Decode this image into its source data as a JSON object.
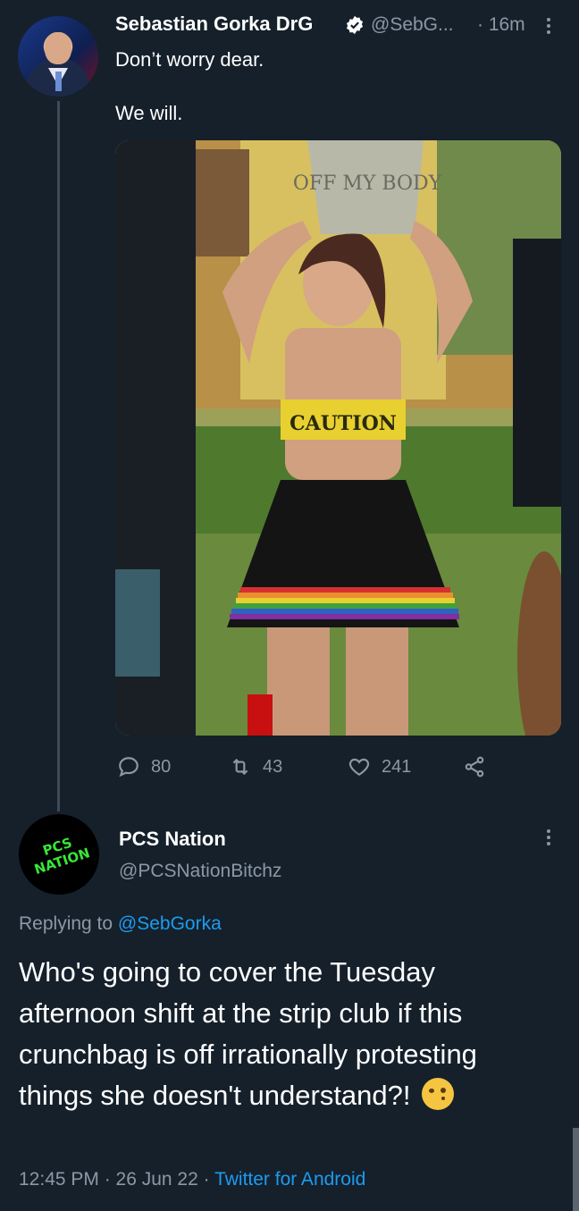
{
  "tweet": {
    "author_name": "Sebastian Gorka DrG",
    "author_handle": "@SebG...",
    "time_ago": "· 16m",
    "text": "Don’t worry dear.\n\nWe will.",
    "photo_sign_text": "OFF MY BODY",
    "photo_shirt_text": "CAUTION",
    "stats": {
      "replies": "80",
      "retweets": "43",
      "likes": "241"
    }
  },
  "reply": {
    "author_name": "PCS Nation",
    "author_handle": "@PCSNationBitchz",
    "avatar_logo_text": "PCS NATION",
    "replying_prefix": "Replying to",
    "replying_handle": "@SebGorka",
    "text": "Who's going to cover the Tuesday afternoon shift at the strip club if this crunchbag is off irrationally protesting things she doesn't understand?!",
    "emoji": "face-with-raised-eyebrow",
    "timestamp": "12:45 PM · 26 Jun 22 · ",
    "source_app": "Twitter for Android"
  },
  "colors": {
    "background": "#15202b",
    "secondary_text": "#8b98a5",
    "link": "#1d9bf0"
  }
}
